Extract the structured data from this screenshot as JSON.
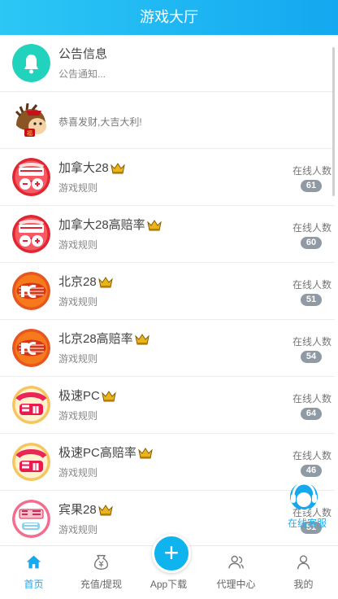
{
  "header": {
    "title": "游戏大厅"
  },
  "notice": {
    "title": "公告信息",
    "subtitle": "公告通知..."
  },
  "greeting": {
    "text": "恭喜发财,大吉大利!"
  },
  "games": [
    {
      "title": "加拿大28",
      "subtitle": "游戏规则",
      "online_label": "在线人数",
      "count": "61",
      "logo": "canada"
    },
    {
      "title": "加拿大28高赔率",
      "subtitle": "游戏规则",
      "online_label": "在线人数",
      "count": "60",
      "logo": "canada"
    },
    {
      "title": "北京28",
      "subtitle": "游戏规则",
      "online_label": "在线人数",
      "count": "51",
      "logo": "pc"
    },
    {
      "title": "北京28高赔率",
      "subtitle": "游戏规则",
      "online_label": "在线人数",
      "count": "54",
      "logo": "pc"
    },
    {
      "title": "极速PC",
      "subtitle": "游戏规则",
      "online_label": "在线人数",
      "count": "64",
      "logo": "speed"
    },
    {
      "title": "极速PC高赔率",
      "subtitle": "游戏规则",
      "online_label": "在线人数",
      "count": "46",
      "logo": "speed"
    },
    {
      "title": "宾果28",
      "subtitle": "游戏规则",
      "online_label": "在线人数",
      "count": "51",
      "logo": "bingo"
    }
  ],
  "floating": {
    "label": "在线客服"
  },
  "tabs": [
    {
      "label": "首页",
      "icon": "home-icon"
    },
    {
      "label": "充值/提现",
      "icon": "wallet-icon"
    },
    {
      "label": "App下载",
      "icon": "plus-icon"
    },
    {
      "label": "代理中心",
      "icon": "users-icon"
    },
    {
      "label": "我的",
      "icon": "user-icon"
    }
  ],
  "colors": {
    "accent": "#19a9ef",
    "header_start": "#2cc7f5",
    "header_end": "#13a8f0",
    "badge": "#8f9aa4"
  }
}
